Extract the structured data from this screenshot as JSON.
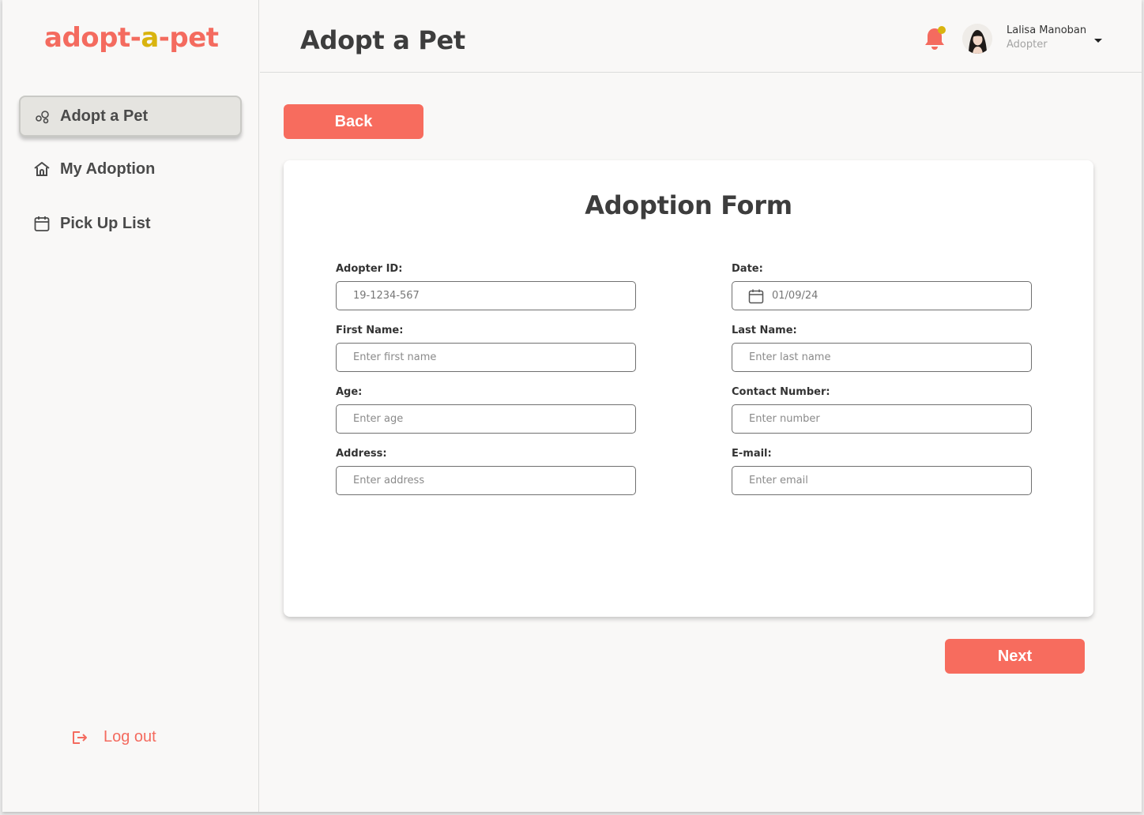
{
  "brand": {
    "logo_part1": "ad",
    "logo_part2": "o",
    "logo_part3": "pt-",
    "logo_part4": "a",
    "logo_part5": "-pet",
    "primary_color": "#f76c5e",
    "accent_color": "#d9b40f"
  },
  "sidebar": {
    "items": [
      {
        "label": "Adopt a Pet",
        "icon": "adopt-pet-icon",
        "active": true
      },
      {
        "label": "My Adoption",
        "icon": "house-icon",
        "active": false
      },
      {
        "label": "Pick Up List",
        "icon": "calendar-icon",
        "active": false
      }
    ],
    "logout_label": "Log out"
  },
  "header": {
    "title": "Adopt a Pet",
    "user_name": "Lalisa Manoban",
    "user_role": "Adopter"
  },
  "actions": {
    "back_label": "Back",
    "next_label": "Next"
  },
  "form": {
    "title": "Adoption Form",
    "adopter_id": {
      "label": "Adopter ID:",
      "value": "19-1234-567"
    },
    "date": {
      "label": "Date:",
      "value": "01/09/24"
    },
    "first_name": {
      "label": "First Name:",
      "placeholder": "Enter first name"
    },
    "last_name": {
      "label": "Last Name:",
      "placeholder": "Enter last name"
    },
    "age": {
      "label": "Age:",
      "placeholder": "Enter age"
    },
    "contact": {
      "label": "Contact Number:",
      "placeholder": "Enter number"
    },
    "address": {
      "label": "Address:",
      "placeholder": "Enter address"
    },
    "email": {
      "label": "E-mail:",
      "placeholder": "Enter email"
    }
  }
}
